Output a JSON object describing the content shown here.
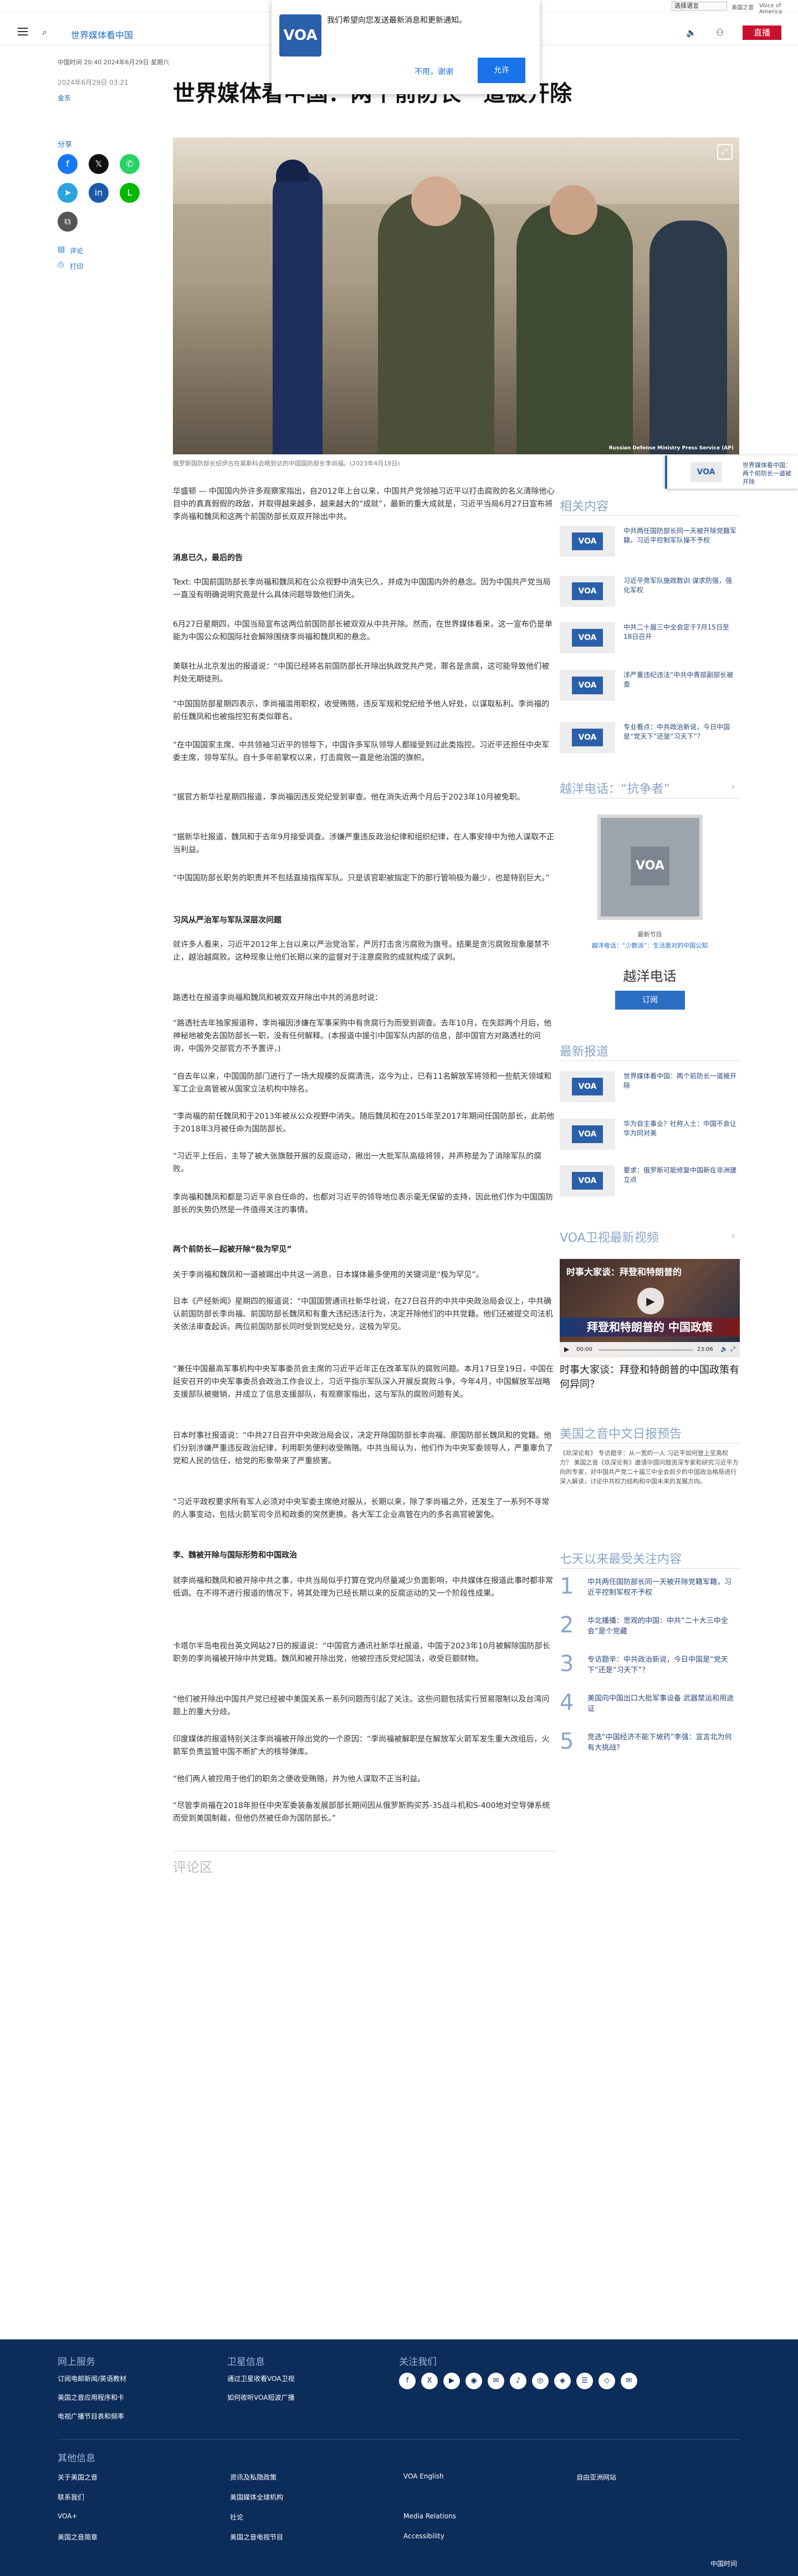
{
  "topbar": {
    "language": "选择语言",
    "site": "美国之音",
    "extra": "Voice of America"
  },
  "header": {
    "section": "世界媒体看中国",
    "live": "直播"
  },
  "notification": {
    "message": "我们希望向您发送最新消息和更新通知。",
    "decline": "不用，谢谢",
    "accept": "允许",
    "logo": "VOA"
  },
  "article": {
    "meta": "中国时间 20:40 2024年6月29日 星期六",
    "date": "2024年6月29日 03:21",
    "author": "金东",
    "title": "世界媒体看中国：两个前防长一道被开除",
    "share_label": "分享",
    "comments_label": "评论",
    "print_label": "打印",
    "photo_watermark": "Russian Defense Ministry Press Service (AP)",
    "caption": "俄罗斯国防部长绍伊古在莫斯科会晤到访的中国国防部长李尚福。(2023年4月18日)",
    "paragraphs": [
      "华盛顿 — 中国国内外许多观察家指出，自2012年上台以来，中国共产党领袖习近平以打击腐败的名义清除他心目中的真真假假的政敌，并取得越来越多，越来越大的“成就”，最新的重大成就是，习近平当局6月27日宣布将李尚福和魏凤和这两个前国防部长双双开除出中共。",
      "消息已久，最后的告",
      "Text: 中国前国防部长李尚福和魏凤和在公众视野中消失已久，并成为中国国内外的悬念。因为中国共产党当局一直没有明确说明究竟是什么具体问题导致他们消失。",
      "6月27日星期四，中国当局宣布这两位前国防部长被双双从中共开除。然而，在世界媒体看来，这一宣布仍是单能为中国公众和国际社会解除围绕李尚福和魏凤和的悬念。",
      "美联社从北京发出的报道说：“中国已经将名前国防部长开除出执政党共产党，罪名是贪腐，这可能导致他们被判处无期徒刑。",
      "“中国国防部星期四表示，李尚福滥用职权，收受贿赂，违反军规和党纪给予他人好处，以谋取私利。李尚福的前任魏凤和也被指控犯有类似罪名。",
      "“在中国国家主席、中共领袖习近平的领导下，中国许多军队领导人都接受到过此类指控。习近平还担任中央军委主席，领导军队。自十多年前掌权以来，打击腐败一直是他治国的旗帜。",
      "“据官方新华社星期四报道，李尚福因违反党纪受到审查。他在消失近两个月后于2023年10月被免职。",
      "“据新华社报道，魏凤和于去年9月接受调查。涉嫌严重违反政治纪律和组织纪律，在人事安排中为他人谋取不正当利益。",
      "“中国国防部长职务的职责并不包括直接指挥军队。只是该官职被指定下的那行管响极为最少，也是特别巨大。”",
      "习风从严治军与军队深层次问题",
      "就许多人看来，习近平2012年上台以来以严治党治军，严厉打击贪污腐败为旗号。结果是贪污腐败现象屡禁不止，越治越腐败。这种现象让他们长期以来的监督对于注意腐败的成就构成了讽刺。",
      "路透社在报道李尚福和魏凤和被双双开除出中共的消息时说：",
      "“路透社去年独家报道称，李尚福因涉嫌在军事采购中有贪腐行为而受到调查。去年10月，在失踪两个月后，他神秘地被免去国防部长一职，没有任何解释。(本报道中援引中国军队内部的信息，部中国官方对路透社的问询，中国外交部官方不予置评，)",
      "“自去年以来，中国国防部门进行了一场大规模的反腐清洗，迄今为止，已有11名解放军将领和一些航天领域和军工企业高管被从国家立法机构中除名。",
      "“李尚福的前任魏凤和于2013年被从公众视野中消失。随后魏凤和在2015年至2017年期间任国防部长，此前他于2018年3月被任命为国防部长。",
      "“习近平上任后，主导了被大张旗鼓开展的反腐运动，揪出一大批军队高级将领，并声称是为了消除军队的腐败。",
      "李尚福和魏凤和都是习近平亲自任命的，也都对习近平的领导地位表示毫无保留的支持，因此他们作为中国国防部长的失势仍然是一件值得关注的事情。",
      "两个前防长—起被开除“极为罕见”",
      "关于李尚福和魏凤和一道被踢出中共这一消息，日本媒体最多使用的关键词是“极为罕见”。",
      "日本《产经新闻》星期四的报道说：“中国国营通讯社新华社说，在27日召开的中共中央政治局会议上，中共确认前国防部长李尚福、前国防部长魏凤和有重大违纪违法行为，决定开除他们的中共党籍。他们还被提交司法机关依法审查起诉。两位前国防部长同时受到党纪处分，这极为罕见。",
      "“兼任中国最高军事机构中央军事委员会主席的习近平近年正在改革军队的腐败问题。本月17日至19日，中国在延安召开的中央军事委员会政治工作会议上，习近平指示军队深入开展反腐败斗争。今年4月，中国解放军战略支援部队被撤销，并成立了信息支援部队，有观察家指出，这与军队的腐败问题有关。",
      "日本时事社报道说：“中共27日召开中央政治局会议，决定开除国防部长李尚福、原国防部长魏凤和的党籍。他们分别涉嫌严重违反政治纪律，利用职务便利收受贿赂。中共当局认为，他们作为中央军委领导人，严重辜负了党和人民的信任，给党的形象带来了严重损害。",
      "“习近平政权要求所有军人必须对中央军委主席绝对服从，长期以来，除了李尚福之外，还发生了一系列不寻常的人事变动，包括火箭军司令员和政委的突然更换。各大军工企业高管在内的多名高官被罢免。",
      "李、魏被开除与国际形势和中国政治",
      "就李尚福和魏凤和被开除中共之事，中共当局似乎打算在党内尽量减少负面影响，中共媒体在报道此事时都非常低调。在不得不进行报道的情况下，将其处理为已经长期以来的反腐运动的又一个阶段性成果。",
      "卡塔尔半岛电视台英文网站27日的报道说：“中国官方通讯社新华社报道，中国于2023年10月被解除国防部长职务的李尚福被开除中共党籍。魏凤和被开除出党，他被控违反党纪国法，收受巨额财物。",
      "“他们被开除出中国共产党已经被中美国关系一系列问题而引起了关注。这些问题包括实行贸易限制以及台湾问题上的重大分歧。",
      "印度媒体的报道特别关注李尚福被开除出党的一个原因：“李尚福被解职是在解放军火箭军发生重大改组后，火箭军负责监管中国不断扩大的核导弹库。",
      "“他们两人被控用于他们的职务之便收受贿赂，并为他人谋取不正当利益。",
      "“尽管李尚福在2018年担任中央军委装备发展部部长期间因从俄罗斯购买苏-35战斗机和S-400地对空导弹系统而受到美国制裁，但他仍然被任命为国防部长。”"
    ],
    "comments_heading": "评论区"
  },
  "sidebar": {
    "related_heading": "相关内容",
    "related": [
      {
        "logo": "VOA",
        "text": "中共两任国防部长同一天被开除党籍军籍，习近平控制军队操不予权"
      },
      {
        "logo": "VOA",
        "text": "习近平旁军队施政数训 谋求防强，强化军权"
      },
      {
        "logo": "VOA",
        "text": "中共二十届三中全会定于7月15日至18日召开"
      },
      {
        "logo": "VOA",
        "text": "涉严重违纪违法“中共中青部副部长被查"
      },
      {
        "logo": "VOA",
        "text": "专业看点：中共政治新说，今日中国是“党天下”还是“习天下”？"
      }
    ],
    "podcast_heading": "越洋电话：“抗争者”",
    "podcast_logo": "VOA",
    "podcast_label": "最新节目",
    "podcast_link": "越洋电话：“少数派”：生活是对的中国公知",
    "podcast_title": "越洋电话",
    "subscribe": "订阅",
    "latest_heading": "最新报道",
    "latest": [
      {
        "logo": "VOA",
        "text": "世界媒体看中国：两个前防长一道被开除"
      },
      {
        "logo": "VOA",
        "text": "华为自主事业？社称人士：中国不会让华为同对美"
      },
      {
        "logo": "VOA",
        "text": "要求：俄罗斯可能修复中国新在非洲建立点"
      }
    ],
    "video_heading": "VOA卫视最新视频",
    "video_overlay_title": "时事大家谈：拜登和特朗普的",
    "video_banner": "拜登和特朗普的 中国政策",
    "video_time": "00:00",
    "video_duration": "23:06",
    "video_title": "时事大家谈：拜登和特朗普的中国政策有何异同？",
    "preview_heading": "美国之音中文日报预告",
    "preview_text": "《玖深论有》 专访题辛：从一宽的一人 习近平如何登上至高权力？ 美国之音《玖深论有》邀请中国问题资深专家和研究习近平方向的专家，对中国共产党二十届三中全会前夕的中国政治格局进行深入解读，讨论中共权力结构和中国未来的发展方向。",
    "top7_heading": "七天以来最受关注内容",
    "top7": [
      {
        "n": "1",
        "text": "中共两任国防部长同一天被开除党籍军籍，习近平控制军权不予权"
      },
      {
        "n": "2",
        "text": "华北播播：悲观的中国：中共“二十大三中全会”是个党藏"
      },
      {
        "n": "3",
        "text": "专访题辛：中共政治新说，今日中国是“党天下”还是“习天下”？"
      },
      {
        "n": "4",
        "text": "美国向中国出口大批军事设备 武器禁运和用途证"
      },
      {
        "n": "5",
        "text": "竞选“中国经济不能下坡药”李强：宣言北为何有大挑战？"
      }
    ],
    "floating_text": "世界媒体看中国：两个前防长一道被开除"
  },
  "footer": {
    "col1_heading": "网上服务",
    "col1": [
      "订阅电邮新闻/英语教材",
      "美国之音应用程序和卡",
      "电视广播节目表和频率"
    ],
    "col2_heading": "卫星信息",
    "col2": [
      "通过卫星收看VOA卫视",
      "如何收听VOA短波广播"
    ],
    "col3_heading": "关注我们",
    "social": [
      "f",
      "X",
      "▶",
      "◉",
      "✉",
      "♪",
      "◎",
      "◈",
      "☰",
      "◇",
      "✉"
    ],
    "other_heading": "其他信息",
    "links": [
      "关于美国之音",
      "联系我们",
      "VOA+",
      "美国之音简章",
      "资讯及私隐政策",
      "美国媒体全球机构",
      "社论",
      "美国之音电视节目",
      "VOA English",
      "Media Relations",
      "Accessibility",
      "自由亚洲网站"
    ],
    "bottom_right": "中国时间"
  },
  "colors": {
    "voa_blue": "#2a5faa",
    "live_red": "#c8102e",
    "footer_navy": "#0c2c5a",
    "link_blue": "#1a6dc4"
  }
}
